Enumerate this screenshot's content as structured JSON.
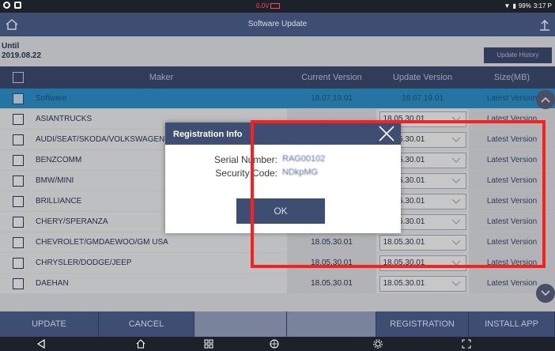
{
  "status_bar": {
    "voltage": "0.0V",
    "battery_pct": "99%",
    "time": "3:17 P"
  },
  "title_bar": {
    "title": "Software Update"
  },
  "info": {
    "until_label": "Until",
    "until_date": "2019.08.22",
    "history_button": "Update History"
  },
  "table": {
    "columns": {
      "maker": "Maker",
      "current": "Current Version",
      "update": "Update Version",
      "size": "Size(MB)"
    },
    "rows": [
      {
        "maker": "Software",
        "current": "18.07.19.01",
        "update": "18.07.19.01",
        "size": "Latest Version",
        "selected": true
      },
      {
        "maker": "ASIANTRUCKS",
        "current": "",
        "update": "18.05.30.01",
        "size": "Latest Version"
      },
      {
        "maker": "AUDI/SEAT/SKODA/VOLKSWAGEN",
        "current": "",
        "update": "18.05.30.01",
        "size": "Latest Version"
      },
      {
        "maker": "BENZCOMM",
        "current": "",
        "update": "18.05.30.01",
        "size": "Latest Version"
      },
      {
        "maker": "BMW/MINI",
        "current": "",
        "update": "18.05.30.01",
        "size": "Latest Version"
      },
      {
        "maker": "BRILLIANCE",
        "current": "",
        "update": "18.05.30.01",
        "size": "Latest Version"
      },
      {
        "maker": "CHERY/SPERANZA",
        "current": "",
        "update": "18.05.30.01",
        "size": "Latest Version"
      },
      {
        "maker": "CHEVROLET/GMDAEWOO/GM USA",
        "current": "18.05.30.01",
        "update": "18.05.30.01",
        "size": "Latest Version"
      },
      {
        "maker": "CHRYSLER/DODGE/JEEP",
        "current": "18.05.30.01",
        "update": "18.05.30.01",
        "size": "Latest Version"
      },
      {
        "maker": "DAEHAN",
        "current": "18.05.30.01",
        "update": "18.05.30.01",
        "size": "Latest Version"
      }
    ]
  },
  "actions": {
    "update": "UPDATE",
    "cancel": "CANCEL",
    "registration": "REGISTRATION",
    "install": "INSTALL APP"
  },
  "dialog": {
    "title": "Registration Info",
    "serial_label": "Serial Number:",
    "serial_value": "RAG00102",
    "security_label": "Security Code:",
    "security_value": "NDkpMG",
    "ok": "OK"
  },
  "colors": {
    "header": "#3e4d72",
    "selected_row": "#2f96d3",
    "highlight": "#ff1e1e"
  }
}
